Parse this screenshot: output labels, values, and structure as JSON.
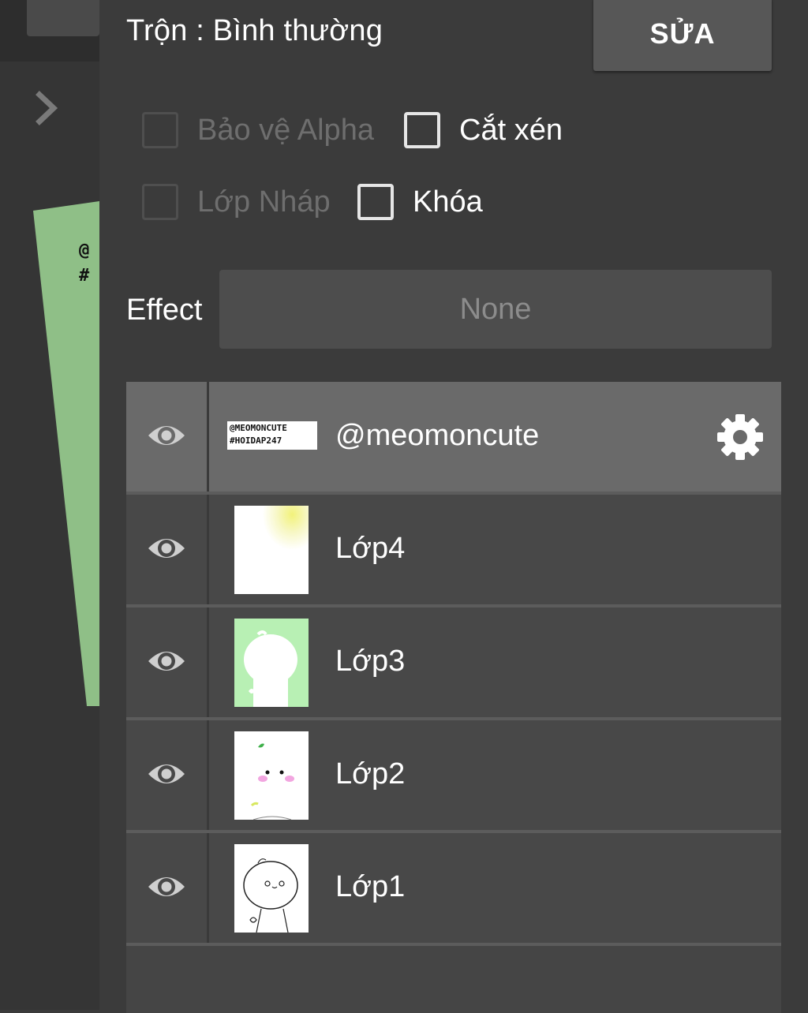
{
  "left": {
    "chevron_icon": "chevron-right-icon",
    "canvas_text_line1": "@",
    "canvas_text_line2": "#",
    "canvas_color": "#8fbf87"
  },
  "panel": {
    "blend_label": "Trộn : Bình thường",
    "edit_button": "SỬA",
    "options": [
      {
        "label": "Bảo vệ Alpha",
        "enabled": false,
        "checked": false
      },
      {
        "label": "Cắt xén",
        "enabled": true,
        "checked": false
      },
      {
        "label": "Lớp Nháp",
        "enabled": false,
        "checked": false
      },
      {
        "label": "Khóa",
        "enabled": true,
        "checked": false
      }
    ],
    "effect_label": "Effect",
    "effect_value": "None",
    "layers": [
      {
        "name": "@meomoncute",
        "thumb_text1": "@MEOMONCUTE",
        "thumb_text2": "#HOIDAP247",
        "selected": true,
        "visible": true
      },
      {
        "name": "Lớp4",
        "selected": false,
        "visible": true
      },
      {
        "name": "Lớp3",
        "selected": false,
        "visible": true
      },
      {
        "name": "Lớp2",
        "selected": false,
        "visible": true
      },
      {
        "name": "Lớp1",
        "selected": false,
        "visible": true
      }
    ],
    "accent": "#6a6a6a"
  }
}
